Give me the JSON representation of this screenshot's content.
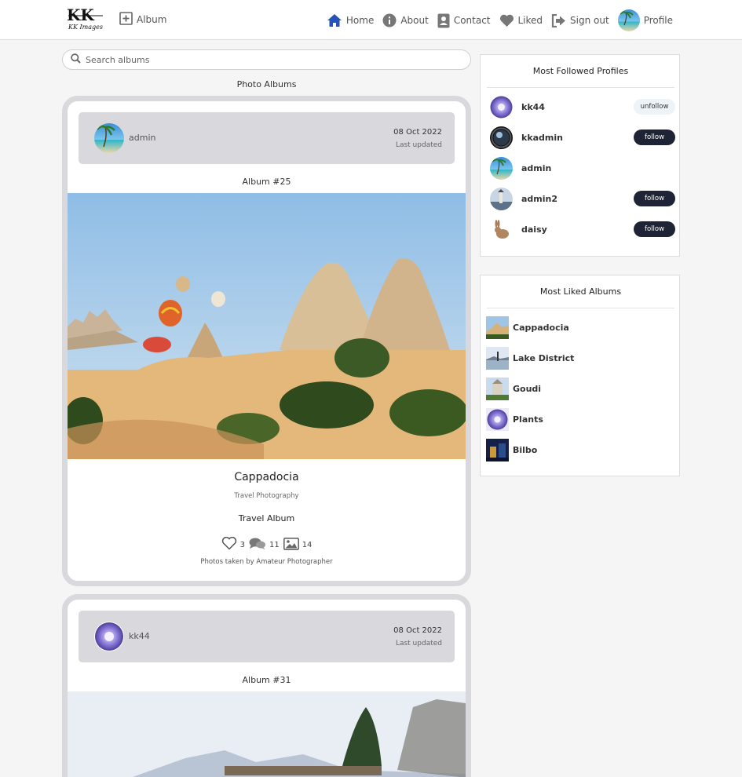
{
  "nav": {
    "logo_text": "KK Images",
    "album_label": "Album",
    "home_label": "Home",
    "about_label": "About",
    "contact_label": "Contact",
    "liked_label": "Liked",
    "signout_label": "Sign out",
    "profile_label": "Profile",
    "accent_color": "#2653b8"
  },
  "search": {
    "placeholder": "Search albums"
  },
  "section_title": "Photo Albums",
  "albums": [
    {
      "username": "admin",
      "date": "08 Oct 2022",
      "updated_label": "Last updated",
      "album_number": "Album #25",
      "name": "Cappadocia",
      "category": "Travel Photography",
      "type": "Travel Album",
      "likes": "3",
      "comments": "11",
      "photos": "14",
      "description": "Photos taken by Amateur Photographer"
    },
    {
      "username": "kk44",
      "date": "08 Oct 2022",
      "updated_label": "Last updated",
      "album_number": "Album #31"
    }
  ],
  "followed": {
    "title": "Most Followed Profiles",
    "profiles": [
      {
        "name": "kk44",
        "action": "unfollow"
      },
      {
        "name": "kkadmin",
        "action": "follow"
      },
      {
        "name": "admin",
        "action": ""
      },
      {
        "name": "admin2",
        "action": "follow"
      },
      {
        "name": "daisy",
        "action": "follow"
      }
    ]
  },
  "liked": {
    "title": "Most Liked Albums",
    "albums": [
      {
        "name": "Cappadocia"
      },
      {
        "name": "Lake District"
      },
      {
        "name": "Goudi"
      },
      {
        "name": "Plants"
      },
      {
        "name": "Bilbo"
      }
    ]
  }
}
